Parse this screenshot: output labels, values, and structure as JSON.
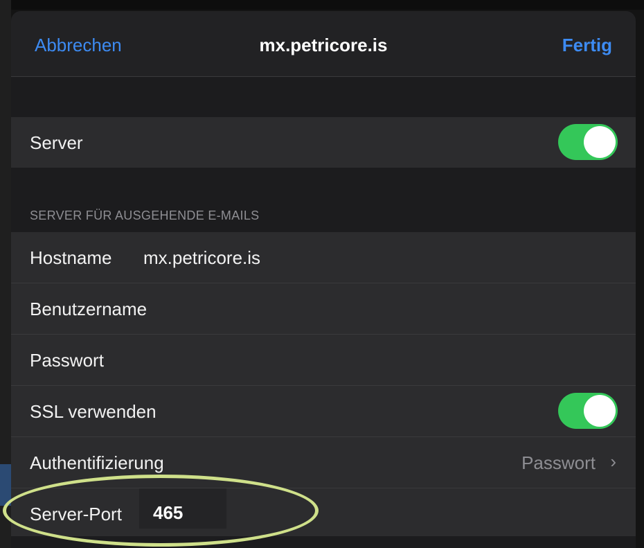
{
  "navbar": {
    "cancel_label": "Abbrechen",
    "title": "mx.petricore.is",
    "done_label": "Fertig",
    "accent_color": "#3d8bf2"
  },
  "server_group": {
    "server_label": "Server",
    "server_toggle_on": true
  },
  "outgoing": {
    "section_header": "SERVER FÜR AUSGEHENDE E-MAILS",
    "hostname_label": "Hostname",
    "hostname_value": "mx.petricore.is",
    "username_label": "Benutzername",
    "password_label": "Passwort",
    "ssl_label": "SSL verwenden",
    "ssl_toggle_on": true,
    "auth_label": "Authentifizierung",
    "auth_value": "Passwort",
    "port_label": "Server-Port",
    "port_value": "465"
  },
  "colors": {
    "toggle_on": "#34c759",
    "highlight_ring": "#cfe08a"
  }
}
